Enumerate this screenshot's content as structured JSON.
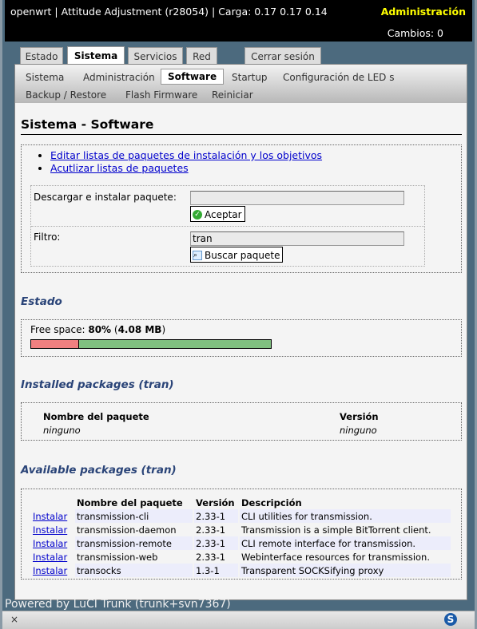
{
  "header": {
    "title": "openwrt | Attitude Adjustment (r28054) | Carga: 0.17 0.17 0.14",
    "admin": "Administración",
    "changes": "Cambios: 0"
  },
  "tabs": [
    "Estado",
    "Sistema",
    "Servicios",
    "Red",
    "Cerrar sesión"
  ],
  "subnav": [
    "Sistema",
    "Administración",
    "Software",
    "Startup",
    "Configuración de LED s",
    "Backup / Restore",
    "Flash Firmware",
    "Reiniciar"
  ],
  "page_title": "Sistema - Software",
  "links": [
    "Editar listas de paquetes de instalación y los objetivos",
    "Acutlizar listas de paquetes"
  ],
  "form": {
    "download_label": "Descargar e instalar paquete:",
    "download_value": "",
    "accept": "Aceptar",
    "filter_label": "Filtro:",
    "filter_value": "tran",
    "search": "Buscar paquete"
  },
  "estado": {
    "title": "Estado",
    "free_label": "Free space: ",
    "free_pct": "80%",
    "free_size": "4.08 MB",
    "used_fraction": 0.2
  },
  "installed": {
    "title": "Installed packages (tran)",
    "col_name": "Nombre del paquete",
    "col_version": "Versión",
    "name": "ninguno",
    "version": "ninguno"
  },
  "available": {
    "title": "Available packages (tran)",
    "cols": [
      "Nombre del paquete",
      "Versión",
      "Descripción"
    ],
    "install": "Instalar",
    "rows": [
      {
        "name": "transmission-cli",
        "version": "2.33-1",
        "desc": "CLI utilities for transmission."
      },
      {
        "name": "transmission-daemon",
        "version": "2.33-1",
        "desc": "Transmission is a simple BitTorrent client."
      },
      {
        "name": "transmission-remote",
        "version": "2.33-1",
        "desc": "CLI remote interface for transmission."
      },
      {
        "name": "transmission-web",
        "version": "2.33-1",
        "desc": "Webinterface resources for transmission."
      },
      {
        "name": "transocks",
        "version": "1.3-1",
        "desc": "Transparent SOCKSifying proxy"
      }
    ]
  },
  "footer": "Powered by LuCI Trunk (trunk+svn7367)",
  "colors": {
    "used": "#f08080",
    "free": "#80c080",
    "admin": "#ffff00"
  }
}
